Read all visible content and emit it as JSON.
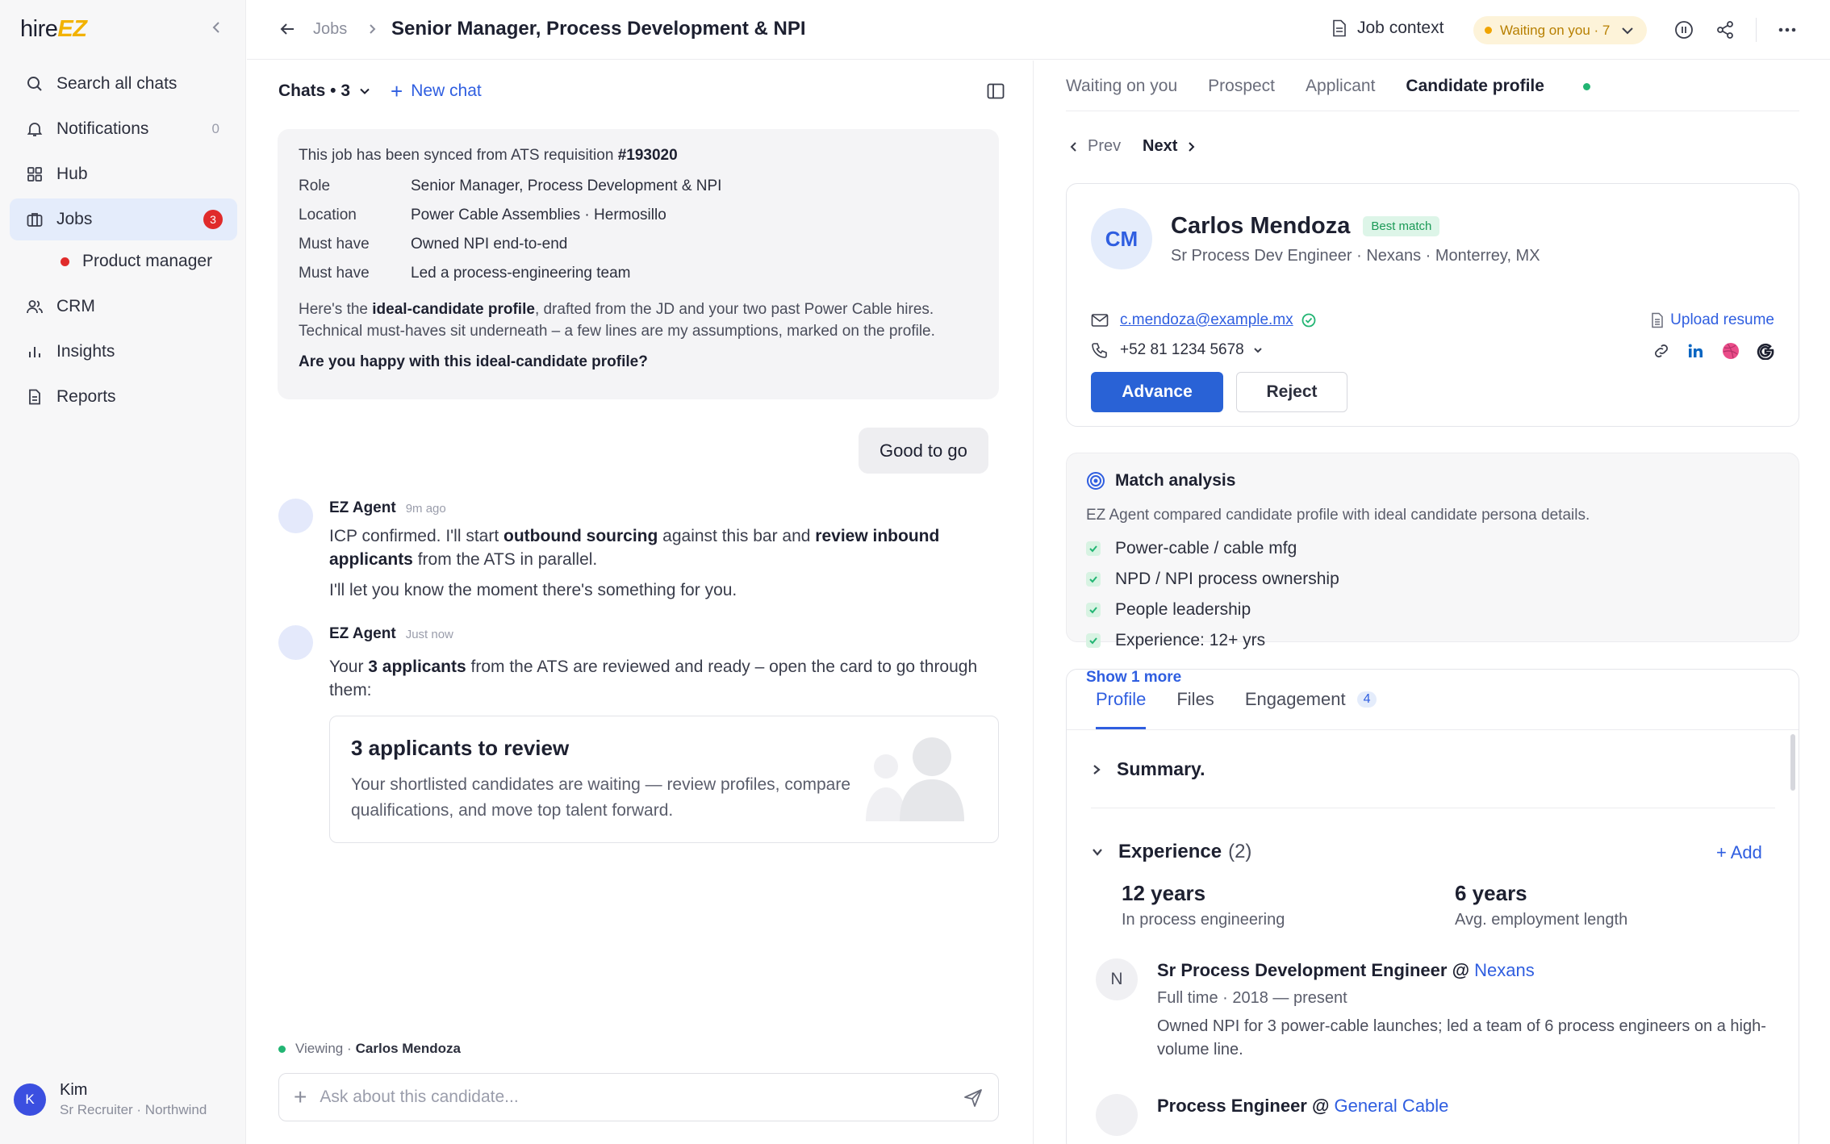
{
  "sidebar": {
    "logo_a": "hire",
    "logo_b": "EZ",
    "items": [
      {
        "label": "Search all chats",
        "icon": "search-icon"
      },
      {
        "label": "Notifications",
        "icon": "bell-icon",
        "count": "0"
      },
      {
        "label": "Hub",
        "icon": "grid-icon"
      },
      {
        "label": "Jobs",
        "icon": "briefcase-icon",
        "badge": "3"
      },
      {
        "label": "CRM",
        "icon": "users-icon"
      },
      {
        "label": "Insights",
        "icon": "bar-chart-icon"
      },
      {
        "label": "Reports",
        "icon": "document-icon"
      }
    ],
    "sub_item": "Product manager",
    "user": {
      "initial": "K",
      "name": "Kim",
      "subtitle": "Sr Recruiter · Northwind"
    }
  },
  "topbar": {
    "crumb": "Jobs",
    "title": "Senior Manager, Process Development & NPI",
    "job_context": "Job context",
    "waiting": "Waiting on you · 7"
  },
  "chat": {
    "header": "Chats • 3",
    "new_chat": "New chat",
    "sync": {
      "prefix": "This job has been synced from ATS requisition ",
      "req": "#193020",
      "rows": [
        {
          "k": "Role",
          "v": "Senior Manager, Process Development & NPI"
        },
        {
          "k": "Location",
          "v": "Power Cable Assemblies · Hermosillo"
        },
        {
          "k": "Must have",
          "v": "Owned NPI end-to-end"
        },
        {
          "k": "Must have",
          "v": "Led a process-engineering team"
        }
      ],
      "para_a": "Here's the ",
      "para_b": "ideal-candidate profile",
      "para_c": ", drafted from the JD and your two past Power Cable hires. Technical must-haves sit underneath – a few lines are my assumptions, marked on the profile.",
      "question": "Are you happy with this ideal-candidate profile?"
    },
    "user_msg": "Good to go",
    "agent1": {
      "name": "EZ Agent",
      "time": "9m ago",
      "t1": "ICP confirmed. I'll start ",
      "t2": "outbound sourcing",
      "t3": " against this bar and ",
      "t4": "review inbound applicants",
      "t5": " from the ATS in parallel.",
      "t6": "I'll let you know the moment there's something for you."
    },
    "agent2": {
      "name": "EZ Agent",
      "time": "Just now",
      "t1": "Your ",
      "t2": "3 applicants",
      "t3": " from the ATS are reviewed and ready – open the card to go through them:"
    },
    "review": {
      "title": "3 applicants to review",
      "desc": "Your shortlisted candidates are waiting — review profiles, compare qualifications, and move top talent forward."
    },
    "viewing_label": "Viewing ·",
    "viewing_name": "Carlos Mendoza",
    "ask_placeholder": "Ask about this candidate..."
  },
  "right": {
    "tabs": [
      "Waiting on you",
      "Prospect",
      "Applicant"
    ],
    "active_tab": "Candidate profile",
    "prev": "Prev",
    "next": "Next",
    "candidate": {
      "initials": "CM",
      "name": "Carlos Mendoza",
      "badge": "Best match",
      "subtitle": "Sr Process Dev Engineer · Nexans · Monterrey, MX",
      "email": "c.mendoza@example.mx",
      "phone": "+52 81 1234 5678",
      "upload": "Upload resume",
      "advance": "Advance",
      "reject": "Reject"
    },
    "match": {
      "title": "Match analysis",
      "desc": "EZ Agent compared candidate profile with ideal candidate persona details.",
      "items": [
        "Power-cable / cable mfg",
        "NPD / NPI process ownership",
        "People leadership",
        "Experience: 12+ yrs"
      ],
      "show_more": "Show 1 more"
    },
    "profile": {
      "tabs": [
        "Profile",
        "Files",
        "Engagement"
      ],
      "engagement_count": "4",
      "summary": "Summary.",
      "experience": "Experience",
      "experience_count": "(2)",
      "add": "+ Add",
      "stat1_n": "12 years",
      "stat1_l": "In process engineering",
      "stat2_n": "6 years",
      "stat2_l": "Avg. employment length",
      "job1": {
        "initial": "N",
        "title": "Sr Process Development Engineer @ ",
        "company": "Nexans",
        "meta": "Full time · 2018 — present",
        "desc": "Owned NPI for 3 power-cable launches; led a team of 6 process engineers on a high-volume line."
      },
      "job2": {
        "title": "Process Engineer @ ",
        "company": "General Cable"
      }
    }
  }
}
